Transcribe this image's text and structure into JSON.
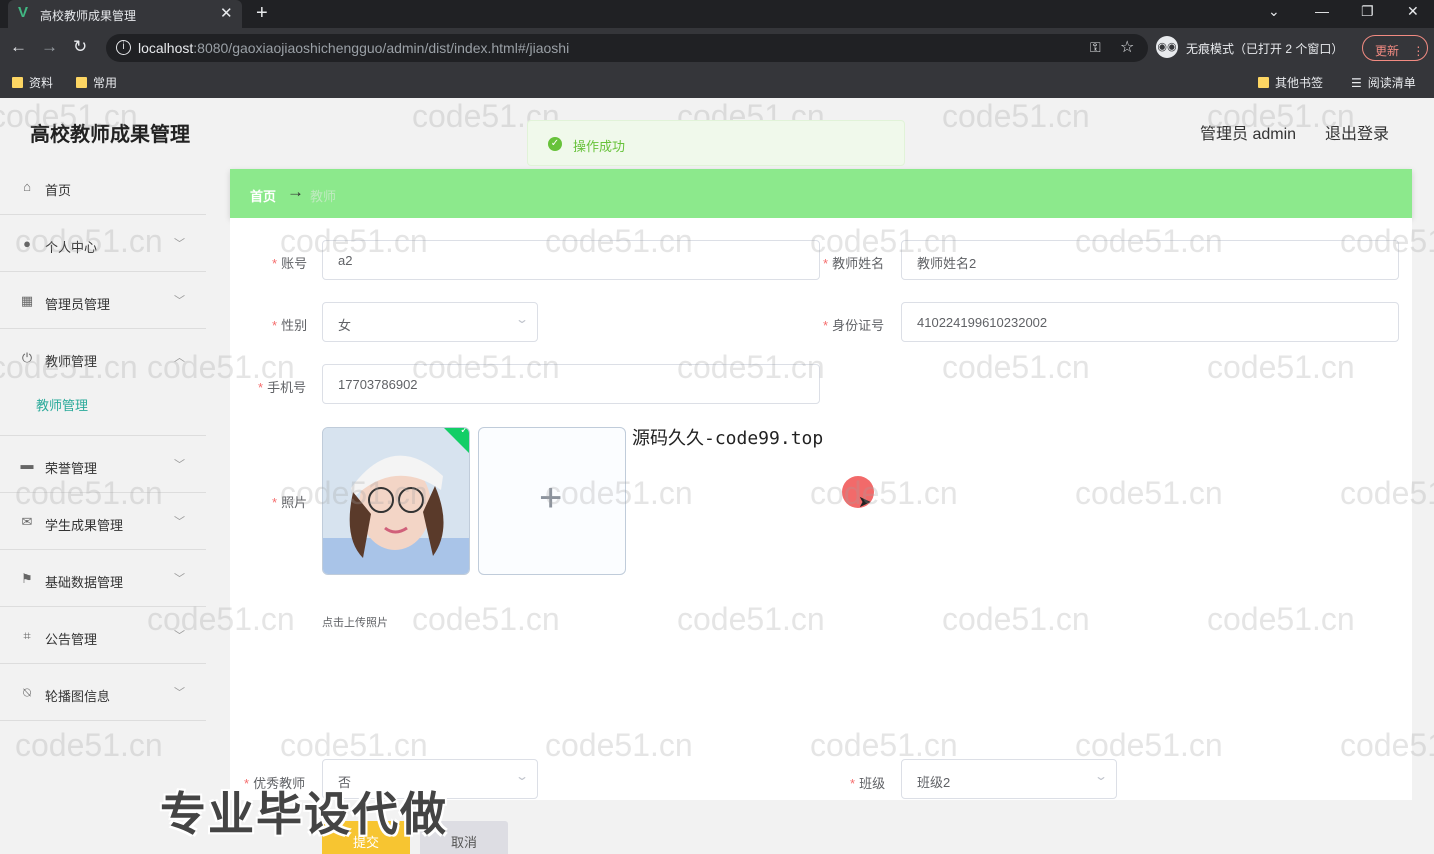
{
  "browser": {
    "tab_title": "高校教师成果管理",
    "tab_favicon": "vue-icon",
    "url_host": "localhost",
    "url_path": ":8080/gaoxiaojiaoshichengguo/admin/dist/index.html#/jiaoshi",
    "incognito_label": "无痕模式（已打开 2 个窗口）",
    "update_label": "更新",
    "bookmarks": [
      "资料",
      "常用"
    ],
    "bookmarks_right": [
      "其他书签",
      "阅读清单"
    ]
  },
  "header": {
    "title": "高校教师成果管理",
    "admin_label": "管理员 admin",
    "logout_label": "退出登录"
  },
  "toast": {
    "message": "操作成功",
    "status": "success",
    "color": "#67c23a"
  },
  "sidebar": {
    "items": [
      {
        "label": "首页",
        "icon": "home-icon"
      },
      {
        "label": "个人中心",
        "icon": "user-icon"
      },
      {
        "label": "管理员管理",
        "icon": "grid-icon"
      },
      {
        "label": "教师管理",
        "icon": "power-icon",
        "expanded": true
      },
      {
        "label": "荣誉管理",
        "icon": "trophy-icon"
      },
      {
        "label": "学生成果管理",
        "icon": "mail-icon"
      },
      {
        "label": "基础数据管理",
        "icon": "flag-icon"
      },
      {
        "label": "公告管理",
        "icon": "crop-icon"
      },
      {
        "label": "轮播图信息",
        "icon": "bell-off-icon"
      }
    ],
    "submenu_active": "教师管理",
    "active_color": "#2aaa9a"
  },
  "breadcrumb": {
    "home": "首页",
    "separator": "→",
    "current": "教师",
    "bg_color": "#8ce98c"
  },
  "form": {
    "account": {
      "label": "账号",
      "value": "a2"
    },
    "teacher_name": {
      "label": "教师姓名",
      "value": "教师姓名2"
    },
    "gender": {
      "label": "性别",
      "value": "女"
    },
    "id_number": {
      "label": "身份证号",
      "value": "410224199610232002"
    },
    "phone": {
      "label": "手机号",
      "value": "17703786902"
    },
    "photo": {
      "label": "照片",
      "upload_tip": "点击上传照片"
    },
    "excellent": {
      "label": "优秀教师",
      "value": "否"
    },
    "class": {
      "label": "班级",
      "value": "班级2"
    },
    "submit_label": "提交",
    "cancel_label": "取消",
    "submit_color": "#f7c531"
  },
  "overlay": {
    "source_text": "源码久久-code99.top",
    "promo_text": "专业毕设代做",
    "watermark": "code51.cn"
  }
}
